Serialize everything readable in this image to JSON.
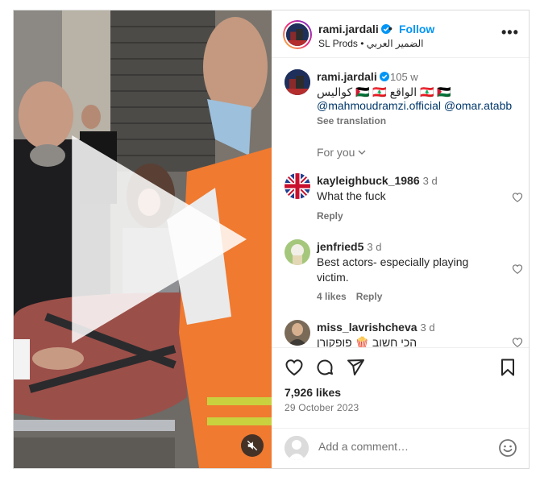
{
  "post": {
    "username": "rami.jardali",
    "follow_label": "Follow",
    "dot": "•",
    "subtitle": "SL Prods • الضمير العربي",
    "more_label": "•••"
  },
  "caption": {
    "username": "rami.jardali",
    "time": "105 w",
    "text": "🇱🇧 🇵🇸 الواقع 🇵🇸 🇱🇧 كواليس",
    "mentions": "@mahmoudramzi.official @omar.atabb",
    "translate_label": "See translation"
  },
  "for_you_label": "For you",
  "comments": [
    {
      "username": "kayleighbuck_1986",
      "time": "3 d",
      "text": "What the fuck",
      "meta": [
        "Reply"
      ]
    },
    {
      "username": "jenfried5",
      "time": "3 d",
      "text": "Best actors- especially playing victim.",
      "meta": [
        "4 likes",
        "Reply"
      ]
    },
    {
      "username": "miss_lavrishcheva",
      "time": "3 d",
      "text": "הכי חשוב 🍿 פופקורן",
      "meta": []
    }
  ],
  "stats": {
    "likes": "7,926 likes",
    "date": "29 October 2023"
  },
  "add_comment": {
    "placeholder": "Add a comment…"
  },
  "icons": [
    "verified-badge-icon",
    "more-icon",
    "chevron-down-icon",
    "heart-icon",
    "comment-icon",
    "share-icon",
    "bookmark-icon",
    "emoji-icon",
    "play-icon",
    "muted-icon"
  ],
  "colors": {
    "link": "#0095f6",
    "mention": "#00376b",
    "secondary_text": "#737373",
    "vest": "#f07a2a"
  }
}
